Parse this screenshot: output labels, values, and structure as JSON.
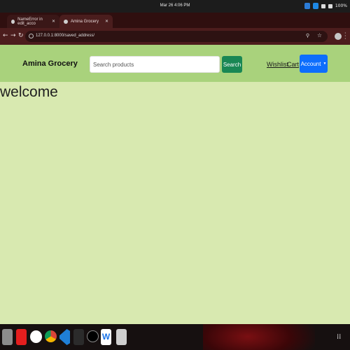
{
  "os": {
    "date": "Mar 26   4:06 PM",
    "battery": "100%"
  },
  "tabs": [
    {
      "title": "NameError in edit_acco"
    },
    {
      "title": "Amina Grocery"
    }
  ],
  "address_bar": {
    "url": "127.0.0.1:8000/saved_address/"
  },
  "navbar": {
    "brand": "Amina Grocery",
    "search_placeholder": "Search products",
    "search_button": "Search",
    "links": {
      "wishlist": "Wishlist",
      "cart": "Cart"
    },
    "account_button": "Account"
  },
  "main": {
    "heading": "welcome"
  },
  "taskbar": {
    "icons": [
      "files-icon",
      "youtube-icon",
      "whatsapp-icon",
      "chrome-icon",
      "vscode-icon",
      "terminal-icon",
      "cs-icon",
      "w-app-icon",
      "trash-icon"
    ],
    "w_label": "W"
  },
  "colors": {
    "navbar_bg": "#a9d27c",
    "page_bg": "#d8e9b0",
    "search_btn": "#198754",
    "account_btn": "#0d6efd"
  }
}
